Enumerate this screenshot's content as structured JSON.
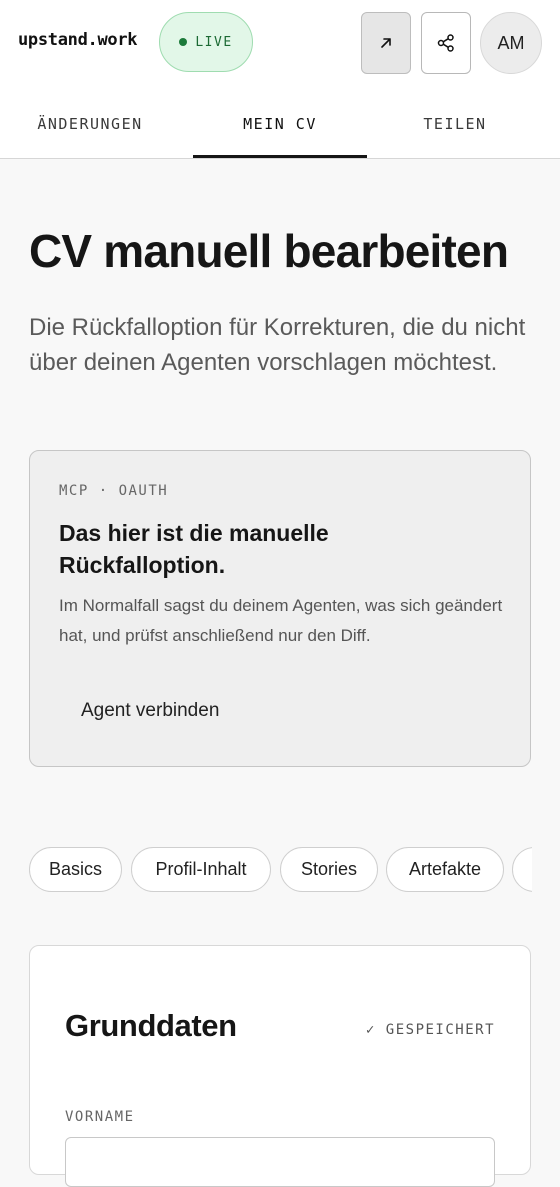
{
  "header": {
    "brand": "upstand.work",
    "status_label": "LIVE",
    "status_color": "#1c7a3a",
    "open_icon": "arrow-up-right-icon",
    "share_icon": "share-icon",
    "avatar_initials": "AM"
  },
  "tabs": [
    {
      "label": "ÄNDERUNGEN",
      "active": false
    },
    {
      "label": "MEIN CV",
      "active": true
    },
    {
      "label": "TEILEN",
      "active": false
    }
  ],
  "main": {
    "title": "CV manuell bearbeiten",
    "lead": "Die Rückfalloption für Korrekturen, die du nicht über deinen Agenten vorschlagen möchtest."
  },
  "info_card": {
    "eyebrow": "MCP · OAUTH",
    "title": "Das hier ist die manuelle Rückfalloption.",
    "text": "Im Normalfall sagst du deinem Agenten, was sich geändert hat, und prüfst anschließend nur den Diff.",
    "link_label": "Agent verbinden"
  },
  "section_chips": [
    "Basics",
    "Profil-Inhalt",
    "Stories",
    "Artefakte"
  ],
  "section": {
    "title": "Grunddaten",
    "status": "✓ GESPEICHERT",
    "fields": [
      {
        "label": "VORNAME",
        "value": ""
      }
    ]
  }
}
